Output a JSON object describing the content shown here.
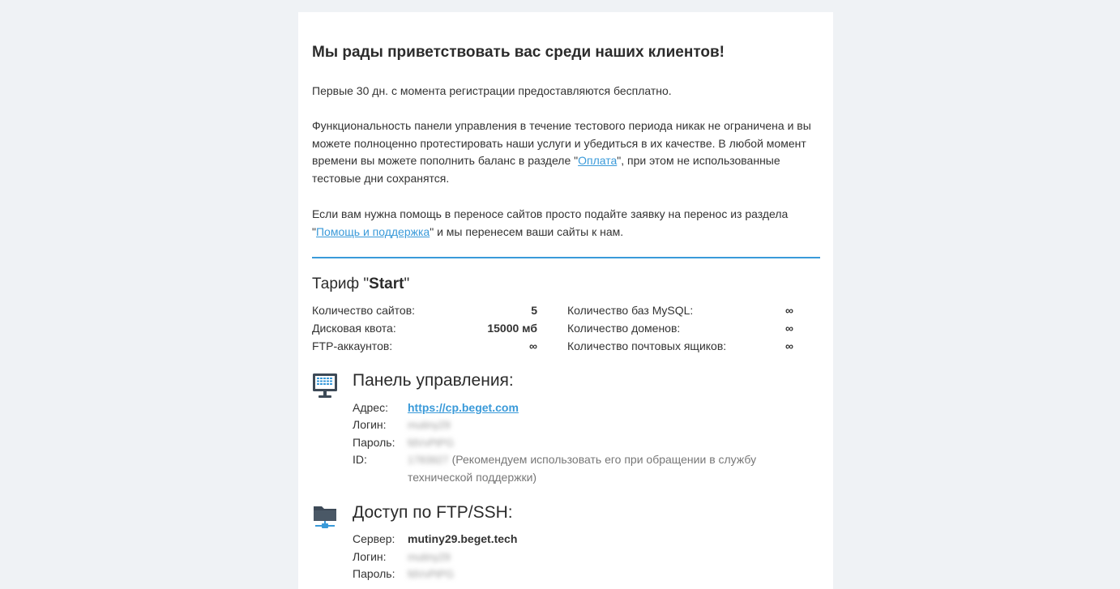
{
  "heading": "Мы рады приветствовать вас среди наших клиентов!",
  "intro": {
    "p1": "Первые 30 дн. с момента регистрации предоставляются бесплатно.",
    "p2_before": "Функциональность панели управления в течение тестового периода никак не ограничена и вы можете полноценно протестировать наши услуги и убедиться в их качестве. В любой момент времени вы можете пополнить баланс в разделе \"",
    "p2_link": "Оплата",
    "p2_after": "\", при этом не использованные тестовые дни сохранятся.",
    "p3_before": "Если вам нужна помощь в переносе сайтов просто подайте заявку на перенос из раздела \"",
    "p3_link": "Помощь и поддержка",
    "p3_after": "\" и мы перенесем ваши сайты к нам."
  },
  "tariff": {
    "prefix": "Тариф \"",
    "name": "Start",
    "suffix": "\"",
    "stats_left": [
      {
        "label": "Количество сайтов:",
        "value": "5"
      },
      {
        "label": "Дисковая квота:",
        "value": "15000 мб"
      },
      {
        "label": "FTP-аккаунтов:",
        "value": "∞"
      }
    ],
    "stats_right": [
      {
        "label": "Количество баз MySQL:",
        "value": "∞"
      },
      {
        "label": "Количество доменов:",
        "value": "∞"
      },
      {
        "label": "Количество почтовых ящиков:",
        "value": "∞"
      }
    ]
  },
  "panel": {
    "title": "Панель управления:",
    "address_label": "Адрес:",
    "address_value": "https://cp.beget.com",
    "login_label": "Логин:",
    "login_value": "mutiny29",
    "password_label": "Пароль:",
    "password_value": "fdVvPtPG",
    "id_label": "ID:",
    "id_value": "1783927",
    "id_note": "(Рекомендуем использовать его при обращении в службу технической поддержки)"
  },
  "ftp": {
    "title": "Доступ по FTP/SSH:",
    "server_label": "Сервер:",
    "server_value": "mutiny29.beget.tech",
    "login_label": "Логин:",
    "login_value": "mutiny29",
    "password_label": "Пароль:",
    "password_value": "fdVvPtPG"
  },
  "colors": {
    "accent": "#3a9ad9",
    "icon_dark": "#3d4a57",
    "background": "#eff2f5"
  },
  "icons": {
    "panel": "monitor-icon",
    "ftp": "folder-network-icon"
  }
}
